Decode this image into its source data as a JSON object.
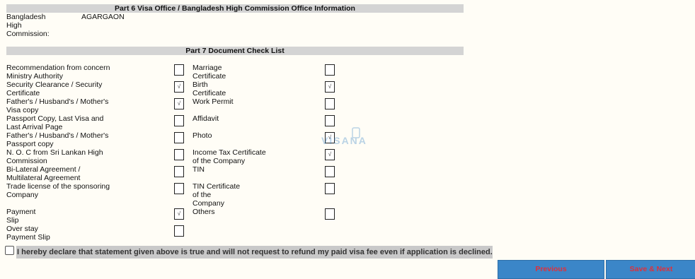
{
  "part6": {
    "title": "Part 6 Visa Office / Bangladesh High Commission Office Information",
    "field_label_lines": [
      "Bangladesh",
      "High",
      "Commission:"
    ],
    "field_value": "AGARGAON"
  },
  "part7": {
    "title": "Part 7 Document Check List",
    "left_items": [
      {
        "label_lines": [
          "Recommendation from concern",
          "Ministry Authority"
        ],
        "checked": false
      },
      {
        "label_lines": [
          "Security Clearance / Security",
          "Certificate"
        ],
        "checked": true
      },
      {
        "label_lines": [
          "Father's / Husband's / Mother's",
          "Visa copy"
        ],
        "checked": true
      },
      {
        "label_lines": [
          "Passport Copy, Last Visa and",
          "Last Arrival Page"
        ],
        "checked": false
      },
      {
        "label_lines": [
          "Father's / Husband's / Mother's",
          "Passport copy"
        ],
        "checked": false
      },
      {
        "label_lines": [
          "N. O. C from Sri Lankan High",
          "Commission"
        ],
        "checked": false
      },
      {
        "label_lines": [
          "Bi-Lateral Agreement /",
          "Multilateral Agreement"
        ],
        "checked": false
      },
      {
        "label_lines": [
          "Trade license of the sponsoring",
          "Company"
        ],
        "checked": false
      },
      {
        "label_lines": [
          "Payment",
          "Slip"
        ],
        "checked": true
      },
      {
        "label_lines": [
          "Over stay",
          "Payment Slip"
        ],
        "checked": false
      }
    ],
    "right_items": [
      {
        "label_lines": [
          "Marriage",
          "Certificate"
        ],
        "checked": false
      },
      {
        "label_lines": [
          "Birth",
          "Certificate"
        ],
        "checked": true
      },
      {
        "label_lines": [
          "Work Permit"
        ],
        "checked": false
      },
      {
        "label_lines": [
          "Affidavit"
        ],
        "checked": false
      },
      {
        "label_lines": [
          "Photo"
        ],
        "checked": true
      },
      {
        "label_lines": [
          "Income Tax Certificate",
          "of the Company"
        ],
        "checked": true
      },
      {
        "label_lines": [
          "TIN"
        ],
        "checked": false
      },
      {
        "label_lines": [
          "TIN Certificate",
          "of the",
          "Company"
        ],
        "checked": false
      },
      {
        "label_lines": [
          "Others"
        ],
        "checked": false
      }
    ],
    "check_mark": "√"
  },
  "declaration": {
    "checked": false,
    "text": "I hereby declare that statement given above is true and will not request to refund my paid visa fee even if application is declined."
  },
  "buttons": {
    "previous": "Previous",
    "save_next": "Save & Next"
  },
  "colors": {
    "header_bg": "#d4d4d4",
    "button_bg": "#3b86c8",
    "button_text": "#e0303a"
  }
}
